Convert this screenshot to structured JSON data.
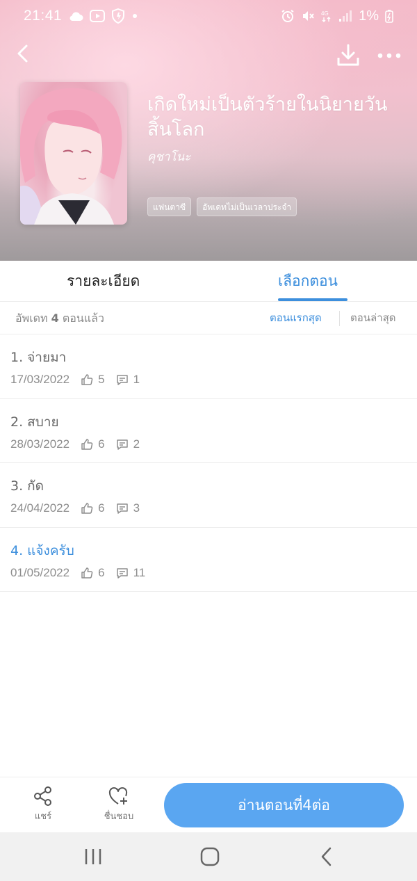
{
  "status_bar": {
    "time": "21:41",
    "battery": "1%",
    "left_icons": [
      "cloud-icon",
      "youtube-icon",
      "shield-icon",
      "dot-icon"
    ],
    "right_icons": [
      "alarm-icon",
      "mute-icon",
      "4g-icon",
      "signal-icon",
      "battery-icon"
    ]
  },
  "header": {
    "back_icon": "chevron-left-icon",
    "download_icon": "download-icon",
    "more_icon": "more-dots-icon"
  },
  "book": {
    "title": "เกิดใหม่เป็นตัวร้ายในนิยายวันสิ้นโลก",
    "author": "คุชาโนะ",
    "tags": [
      "แฟนตาซี",
      "อัพเดทไม่เป็นเวลาประจำ"
    ]
  },
  "tabs": {
    "details": "รายละเอียด",
    "chapters": "เลือกตอน",
    "active": "chapters"
  },
  "list_header": {
    "update_prefix": "อัพเดท",
    "update_count": "4",
    "update_suffix": "ตอนแล้ว",
    "sort_first": "ตอนแรกสุด",
    "sort_latest": "ตอนล่าสุด"
  },
  "chapters": [
    {
      "title": "1. จ่ายมา",
      "date": "17/03/2022",
      "likes": "5",
      "comments": "1",
      "current": false
    },
    {
      "title": "2. สบาย",
      "date": "28/03/2022",
      "likes": "6",
      "comments": "2",
      "current": false
    },
    {
      "title": "3. กัด",
      "date": "24/04/2022",
      "likes": "6",
      "comments": "3",
      "current": false
    },
    {
      "title": "4. แจ้งครับ",
      "date": "01/05/2022",
      "likes": "6",
      "comments": "11",
      "current": true
    }
  ],
  "actions": {
    "share_label": "แชร์",
    "like_label": "ชื่นชอบ",
    "read_button": "อ่านตอนที่4ต่อ"
  },
  "colors": {
    "accent": "#3d8fdd",
    "button": "#5aa6f1",
    "hero_pink": "#f2b6c4"
  }
}
